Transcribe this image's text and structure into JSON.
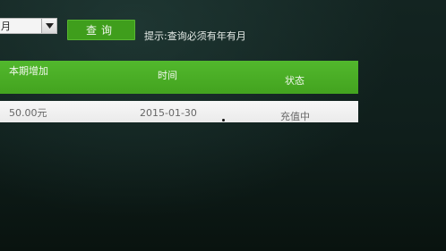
{
  "filter": {
    "month_value": "月",
    "query_label": "查询",
    "hint": "提示:查询必须有年有月"
  },
  "table": {
    "headers": [
      "本期增加",
      "时间",
      "状态"
    ],
    "rows": [
      {
        "amount": "50.00元",
        "time": "2015-01-30",
        "status": "充值中"
      }
    ]
  },
  "colors": {
    "accent_green": "#43a31f",
    "background": "#0d1a18"
  },
  "icons": [
    "chevron-down-icon"
  ]
}
